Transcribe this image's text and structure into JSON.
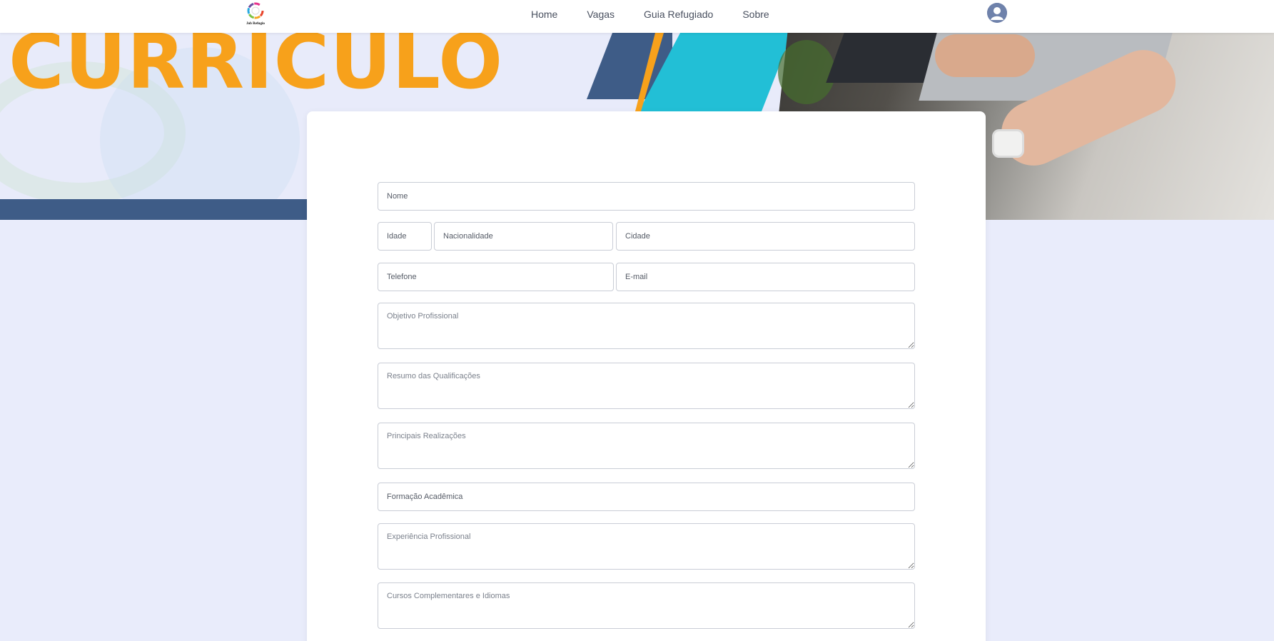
{
  "app": {
    "logo_text": "Job Refugio"
  },
  "nav": {
    "items": [
      {
        "label": "Home"
      },
      {
        "label": "Vagas"
      },
      {
        "label": "Guia Refugiado"
      },
      {
        "label": "Sobre"
      }
    ]
  },
  "hero": {
    "title": "CURRICULO"
  },
  "form": {
    "nome": {
      "placeholder": "Nome",
      "value": ""
    },
    "idade": {
      "placeholder": "Idade",
      "value": ""
    },
    "nacionalidade": {
      "placeholder": "Nacionalidade",
      "value": ""
    },
    "cidade": {
      "placeholder": "Cidade",
      "value": ""
    },
    "telefone": {
      "placeholder": "Telefone",
      "value": ""
    },
    "email": {
      "placeholder": "E-mail",
      "value": ""
    },
    "objetivo": {
      "placeholder": "Objetivo Profissional"
    },
    "resumo": {
      "placeholder": "Resumo das Qualificações"
    },
    "realizacoes": {
      "placeholder": "Principais Realizações"
    },
    "formacao": {
      "placeholder": "Formação Acadêmica",
      "value": ""
    },
    "experiencia": {
      "placeholder": "Experiência Profissional"
    },
    "cursos": {
      "placeholder": "Cursos Complementares e Idiomas"
    }
  },
  "colors": {
    "accent_orange": "#f7a11b",
    "navy": "#3e5c87",
    "cyan": "#22bfd6",
    "background": "#e9ecfb"
  },
  "icons": {
    "avatar": "user-avatar-icon",
    "logo": "colorful-ring-logo"
  }
}
